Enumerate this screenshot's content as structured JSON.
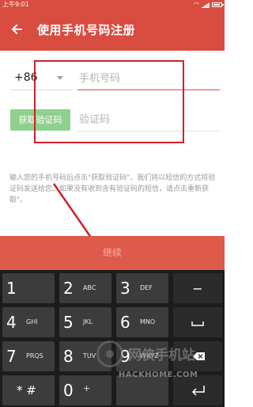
{
  "status_bar": {
    "time": "上午9:01"
  },
  "app_bar": {
    "title": "使用手机号码注册",
    "back_icon": "arrow-left-icon"
  },
  "form": {
    "country_code": "+86",
    "phone_placeholder": "手机号码",
    "get_code_label": "获取验证码",
    "code_placeholder": "验证码",
    "hint": "输入您的手机号码后点击\"获取验证码\"，我们将以短信的方式将验证码发送给您。如果没有收到含有验证码的短信，请点击重新获取\"。"
  },
  "continue_label": "继续",
  "keypad": {
    "keys": [
      {
        "num": "1",
        "sub": ""
      },
      {
        "num": "2",
        "sub": "ABC"
      },
      {
        "num": "3",
        "sub": "DEF"
      },
      {
        "num": "4",
        "sub": "GHI"
      },
      {
        "num": "5",
        "sub": "JKL"
      },
      {
        "num": "6",
        "sub": "MNO"
      },
      {
        "num": "7",
        "sub": "PRQS"
      },
      {
        "num": "8",
        "sub": "TUV"
      },
      {
        "num": "9",
        "sub": "WXYZ"
      },
      {
        "num": "* #",
        "sub": ""
      },
      {
        "num": "0",
        "sub": "+"
      }
    ],
    "function_keys": [
      "minus",
      "space",
      "backspace",
      "enter"
    ]
  },
  "watermark": {
    "title": "网侠手机站",
    "url": "HACKHOME.COM"
  },
  "colors": {
    "accent": "#d94c40",
    "continue_bg": "#de5a4a",
    "get_code_bg": "#8ed08e",
    "annotation": "#d0202a",
    "keypad_bg": "#1c1c1c",
    "key_bg": "#3c3c3c"
  }
}
